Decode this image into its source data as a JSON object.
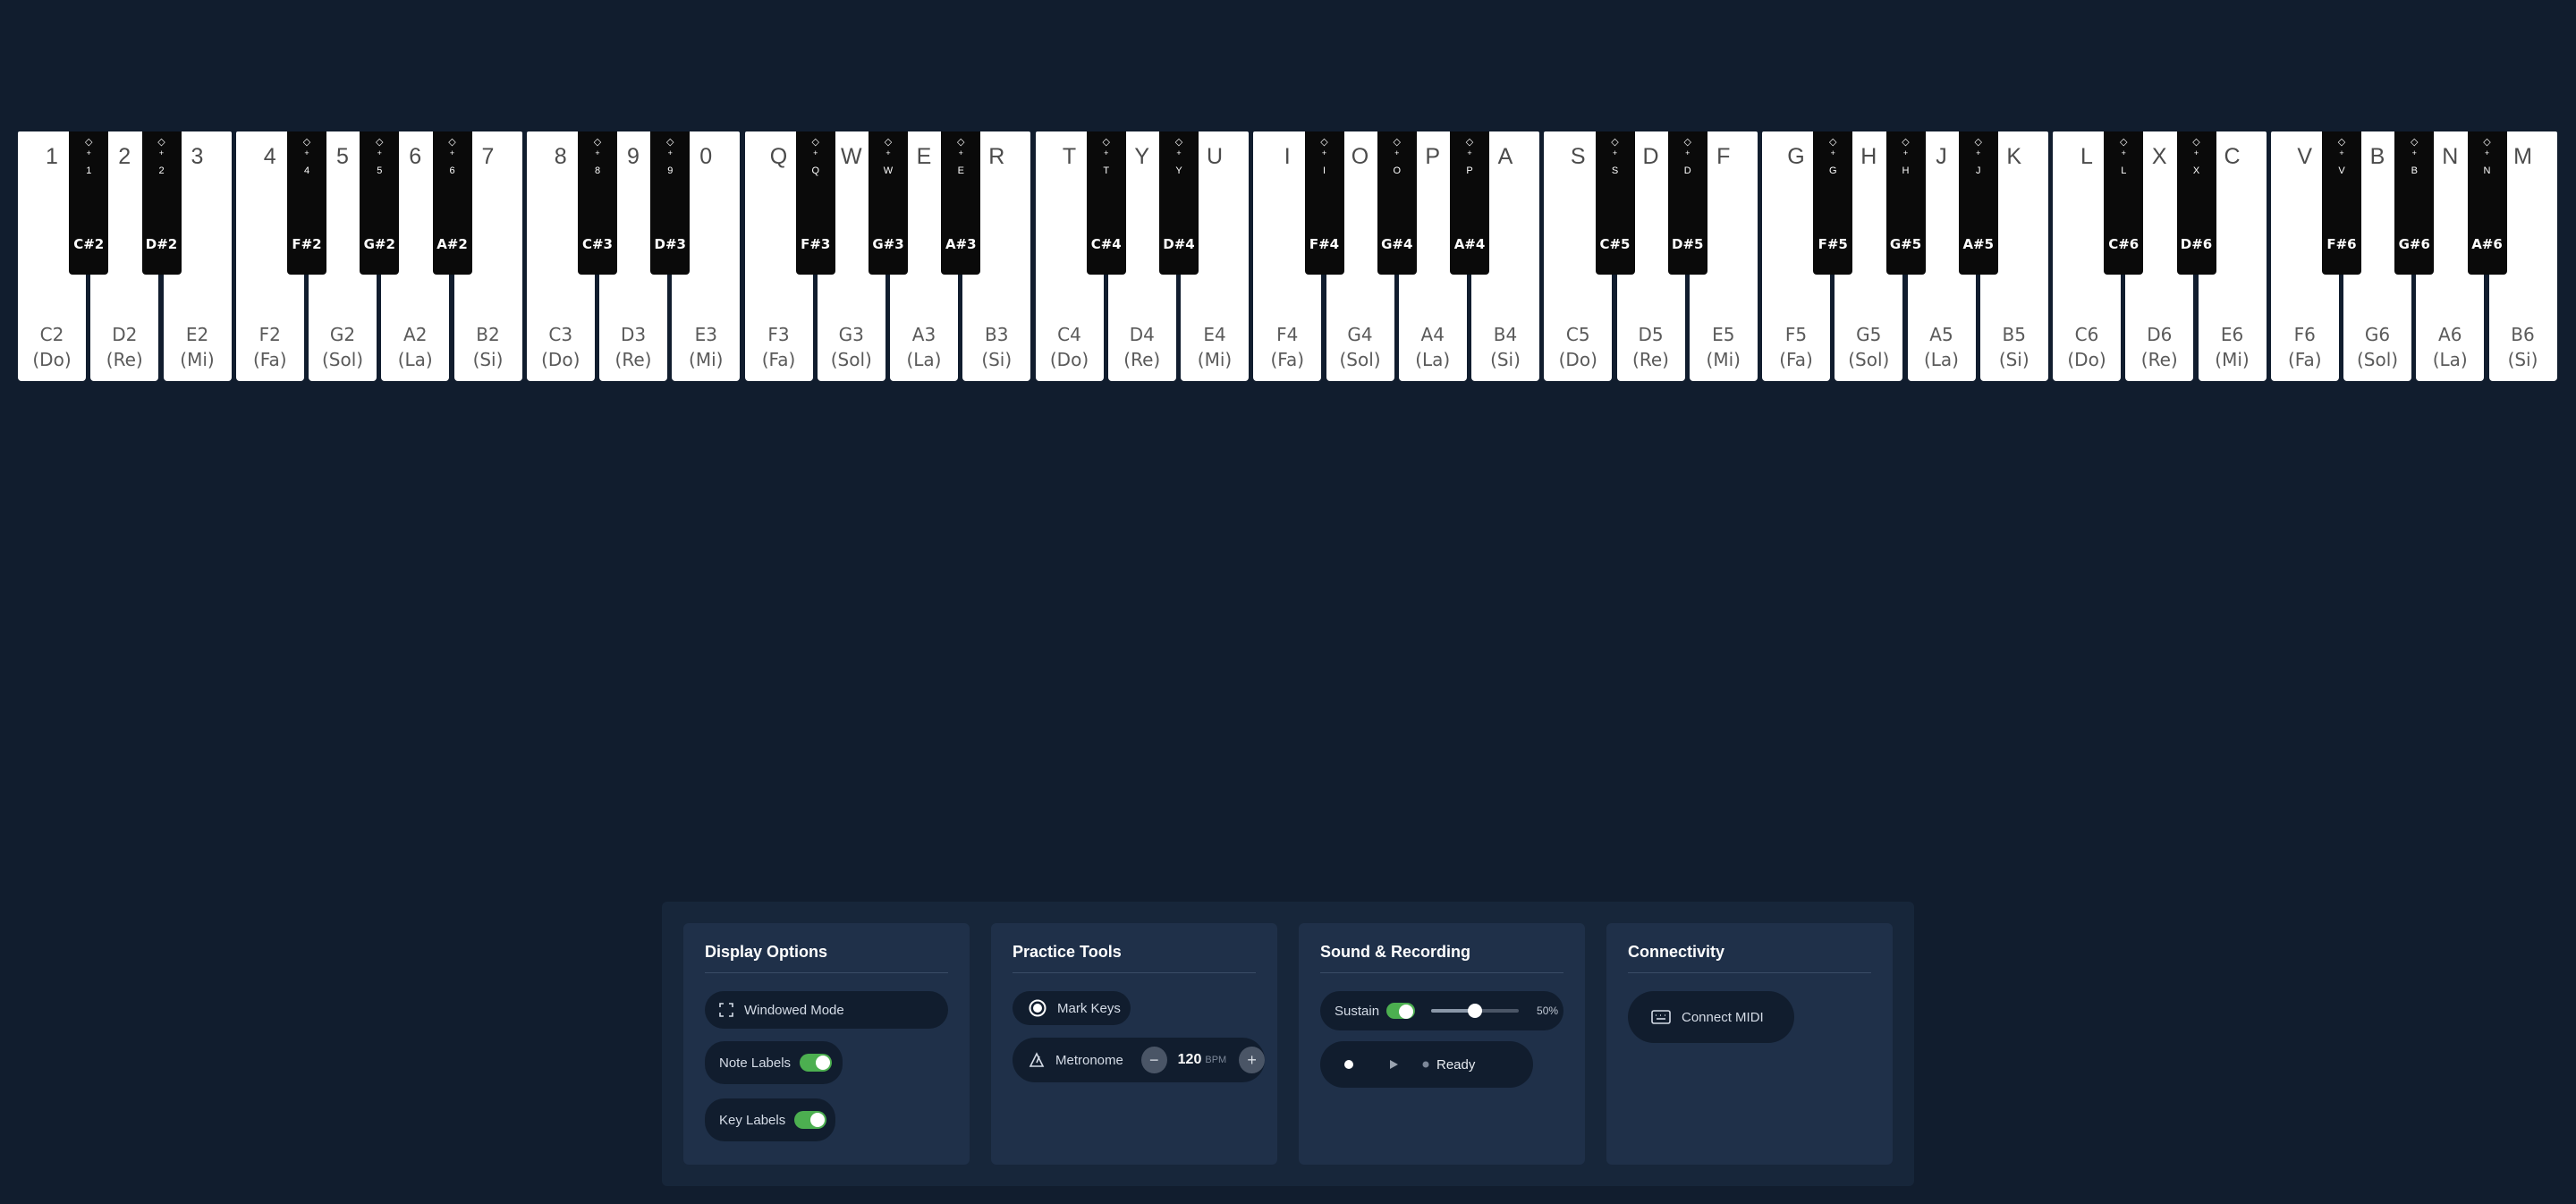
{
  "keyboard": {
    "white_keys": [
      {
        "key": "1",
        "note": "C2",
        "solfege": "(Do)"
      },
      {
        "key": "2",
        "note": "D2",
        "solfege": "(Re)"
      },
      {
        "key": "3",
        "note": "E2",
        "solfege": "(Mi)"
      },
      {
        "key": "4",
        "note": "F2",
        "solfege": "(Fa)"
      },
      {
        "key": "5",
        "note": "G2",
        "solfege": "(Sol)"
      },
      {
        "key": "6",
        "note": "A2",
        "solfege": "(La)"
      },
      {
        "key": "7",
        "note": "B2",
        "solfege": "(Si)"
      },
      {
        "key": "8",
        "note": "C3",
        "solfege": "(Do)"
      },
      {
        "key": "9",
        "note": "D3",
        "solfege": "(Re)"
      },
      {
        "key": "0",
        "note": "E3",
        "solfege": "(Mi)"
      },
      {
        "key": "Q",
        "note": "F3",
        "solfege": "(Fa)"
      },
      {
        "key": "W",
        "note": "G3",
        "solfege": "(Sol)"
      },
      {
        "key": "E",
        "note": "A3",
        "solfege": "(La)"
      },
      {
        "key": "R",
        "note": "B3",
        "solfege": "(Si)"
      },
      {
        "key": "T",
        "note": "C4",
        "solfege": "(Do)"
      },
      {
        "key": "Y",
        "note": "D4",
        "solfege": "(Re)"
      },
      {
        "key": "U",
        "note": "E4",
        "solfege": "(Mi)"
      },
      {
        "key": "I",
        "note": "F4",
        "solfege": "(Fa)"
      },
      {
        "key": "O",
        "note": "G4",
        "solfege": "(Sol)"
      },
      {
        "key": "P",
        "note": "A4",
        "solfege": "(La)"
      },
      {
        "key": "A",
        "note": "B4",
        "solfege": "(Si)"
      },
      {
        "key": "S",
        "note": "C5",
        "solfege": "(Do)"
      },
      {
        "key": "D",
        "note": "D5",
        "solfege": "(Re)"
      },
      {
        "key": "F",
        "note": "E5",
        "solfege": "(Mi)"
      },
      {
        "key": "G",
        "note": "F5",
        "solfege": "(Fa)"
      },
      {
        "key": "H",
        "note": "G5",
        "solfege": "(Sol)"
      },
      {
        "key": "J",
        "note": "A5",
        "solfege": "(La)"
      },
      {
        "key": "K",
        "note": "B5",
        "solfege": "(Si)"
      },
      {
        "key": "L",
        "note": "C6",
        "solfege": "(Do)"
      },
      {
        "key": "X",
        "note": "D6",
        "solfege": "(Re)"
      },
      {
        "key": "C",
        "note": "E6",
        "solfege": "(Mi)"
      },
      {
        "key": "V",
        "note": "F6",
        "solfege": "(Fa)"
      },
      {
        "key": "B",
        "note": "G6",
        "solfege": "(Sol)"
      },
      {
        "key": "N",
        "note": "A6",
        "solfege": "(La)"
      },
      {
        "key": "M",
        "note": "B6",
        "solfege": "(Si)"
      }
    ],
    "black_keys": [
      {
        "after": 0,
        "modifier": "◇",
        "plus": "+",
        "key": "1",
        "note": "C#2"
      },
      {
        "after": 1,
        "modifier": "◇",
        "plus": "+",
        "key": "2",
        "note": "D#2"
      },
      {
        "after": 3,
        "modifier": "◇",
        "plus": "+",
        "key": "4",
        "note": "F#2"
      },
      {
        "after": 4,
        "modifier": "◇",
        "plus": "+",
        "key": "5",
        "note": "G#2"
      },
      {
        "after": 5,
        "modifier": "◇",
        "plus": "+",
        "key": "6",
        "note": "A#2"
      },
      {
        "after": 7,
        "modifier": "◇",
        "plus": "+",
        "key": "8",
        "note": "C#3"
      },
      {
        "after": 8,
        "modifier": "◇",
        "plus": "+",
        "key": "9",
        "note": "D#3"
      },
      {
        "after": 10,
        "modifier": "◇",
        "plus": "+",
        "key": "Q",
        "note": "F#3"
      },
      {
        "after": 11,
        "modifier": "◇",
        "plus": "+",
        "key": "W",
        "note": "G#3"
      },
      {
        "after": 12,
        "modifier": "◇",
        "plus": "+",
        "key": "E",
        "note": "A#3"
      },
      {
        "after": 14,
        "modifier": "◇",
        "plus": "+",
        "key": "T",
        "note": "C#4"
      },
      {
        "after": 15,
        "modifier": "◇",
        "plus": "+",
        "key": "Y",
        "note": "D#4"
      },
      {
        "after": 17,
        "modifier": "◇",
        "plus": "+",
        "key": "I",
        "note": "F#4"
      },
      {
        "after": 18,
        "modifier": "◇",
        "plus": "+",
        "key": "O",
        "note": "G#4"
      },
      {
        "after": 19,
        "modifier": "◇",
        "plus": "+",
        "key": "P",
        "note": "A#4"
      },
      {
        "after": 21,
        "modifier": "◇",
        "plus": "+",
        "key": "S",
        "note": "C#5"
      },
      {
        "after": 22,
        "modifier": "◇",
        "plus": "+",
        "key": "D",
        "note": "D#5"
      },
      {
        "after": 24,
        "modifier": "◇",
        "plus": "+",
        "key": "G",
        "note": "F#5"
      },
      {
        "after": 25,
        "modifier": "◇",
        "plus": "+",
        "key": "H",
        "note": "G#5"
      },
      {
        "after": 26,
        "modifier": "◇",
        "plus": "+",
        "key": "J",
        "note": "A#5"
      },
      {
        "after": 28,
        "modifier": "◇",
        "plus": "+",
        "key": "L",
        "note": "C#6"
      },
      {
        "after": 29,
        "modifier": "◇",
        "plus": "+",
        "key": "X",
        "note": "D#6"
      },
      {
        "after": 31,
        "modifier": "◇",
        "plus": "+",
        "key": "V",
        "note": "F#6"
      },
      {
        "after": 32,
        "modifier": "◇",
        "plus": "+",
        "key": "B",
        "note": "G#6"
      },
      {
        "after": 33,
        "modifier": "◇",
        "plus": "+",
        "key": "N",
        "note": "A#6"
      }
    ]
  },
  "panels": {
    "display": {
      "title": "Display Options",
      "windowed_label": "Windowed Mode",
      "note_labels_label": "Note Labels",
      "note_labels_on": true,
      "key_labels_label": "Key Labels",
      "key_labels_on": true
    },
    "practice": {
      "title": "Practice Tools",
      "mark_keys_label": "Mark Keys",
      "metronome_label": "Metronome",
      "minus": "−",
      "plus": "+",
      "bpm_value": "120",
      "bpm_unit": "BPM"
    },
    "sound": {
      "title": "Sound & Recording",
      "sustain_label": "Sustain",
      "sustain_on": true,
      "volume_value": "50%",
      "volume_fraction": 0.5,
      "status": "Ready"
    },
    "connectivity": {
      "title": "Connectivity",
      "midi_label": "Connect MIDI"
    }
  },
  "colors": {
    "background": "#111d2e",
    "toggle_on": "#4caf50",
    "panel": "#1f3049"
  }
}
